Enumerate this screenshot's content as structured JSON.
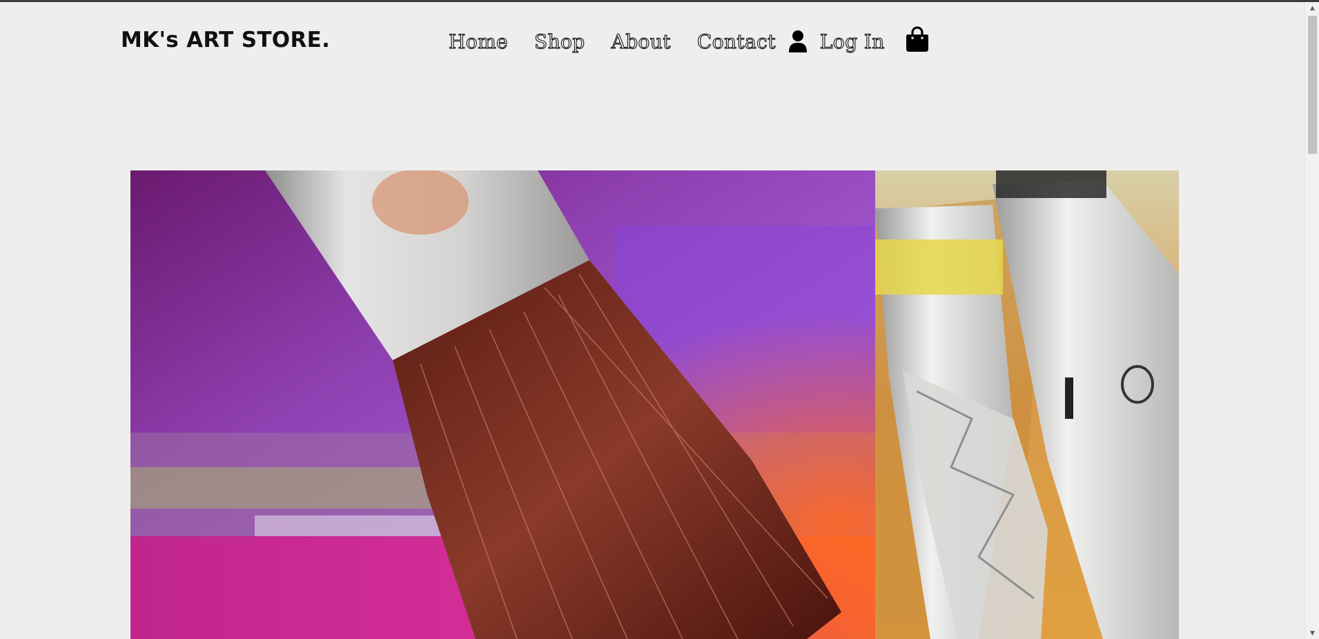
{
  "brand": {
    "name": "MK's ART STORE."
  },
  "nav": {
    "items": [
      {
        "label": "Home"
      },
      {
        "label": "Shop"
      },
      {
        "label": "About"
      },
      {
        "label": "Contact"
      }
    ],
    "login_label": "Log In",
    "user_icon": "user-icon",
    "cart_icon": "shopping-bag-icon"
  },
  "hero": {
    "images": [
      {
        "name": "paintbrush-photo"
      },
      {
        "name": "paint-tubes-photo"
      }
    ]
  },
  "colors": {
    "background": "#eeeeee",
    "text": "#111111"
  }
}
